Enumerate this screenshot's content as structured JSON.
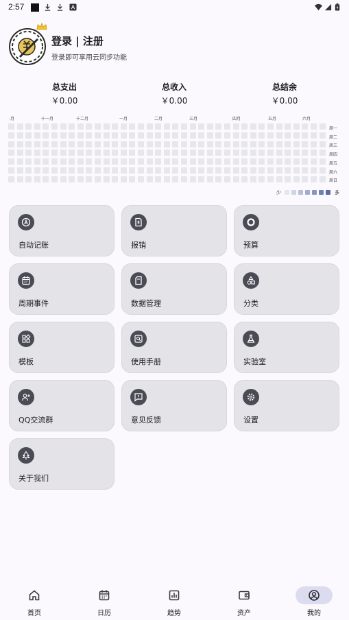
{
  "status_bar": {
    "time": "2:57",
    "icons": [
      "app-square-icon",
      "download-icon",
      "download-icon",
      "font-icon",
      "wifi-icon",
      "signal-icon",
      "battery-icon"
    ]
  },
  "profile": {
    "title": "登录 | 注册",
    "subtitle": "登录即可享用云同步功能"
  },
  "summary": [
    {
      "label": "总支出",
      "value": "￥0.00"
    },
    {
      "label": "总收入",
      "value": "￥0.00"
    },
    {
      "label": "总结余",
      "value": "￥0.00"
    }
  ],
  "heatmap": {
    "months": [
      "十月",
      "十一月",
      "十二月",
      "一月",
      "二月",
      "三月",
      "四月",
      "五月",
      "六月"
    ],
    "weekdays": [
      "周一",
      "周二",
      "周三",
      "周四",
      "周五",
      "周六",
      "周日"
    ],
    "legend_less": "少",
    "legend_more": "多",
    "empty_color": "#e6e6ec",
    "legend_colors": [
      "#e4e6ee",
      "#cfd3e3",
      "#b8bfd8",
      "#a1abcc",
      "#8996be",
      "#7080b0",
      "#5a6ca4"
    ]
  },
  "cards": [
    {
      "label": "自动记账",
      "icon": "auto-a-icon"
    },
    {
      "label": "报销",
      "icon": "receipt-icon"
    },
    {
      "label": "预算",
      "icon": "ring-icon"
    },
    {
      "label": "周期事件",
      "icon": "calendar-icon"
    },
    {
      "label": "数据管理",
      "icon": "sd-card-icon"
    },
    {
      "label": "分类",
      "icon": "category-shapes-icon"
    },
    {
      "label": "模板",
      "icon": "widgets-icon"
    },
    {
      "label": "使用手册",
      "icon": "manual-search-icon"
    },
    {
      "label": "实验室",
      "icon": "flask-icon"
    },
    {
      "label": "QQ交流群",
      "icon": "group-add-icon"
    },
    {
      "label": "意见反馈",
      "icon": "feedback-icon"
    },
    {
      "label": "设置",
      "icon": "gear-icon"
    },
    {
      "label": "关于我们",
      "icon": "tree-icon"
    }
  ],
  "nav": [
    {
      "label": "首页",
      "icon": "home-icon",
      "active": false
    },
    {
      "label": "日历",
      "icon": "calendar-icon",
      "active": false
    },
    {
      "label": "趋势",
      "icon": "chart-icon",
      "active": false
    },
    {
      "label": "资产",
      "icon": "wallet-icon",
      "active": false
    },
    {
      "label": "我的",
      "icon": "account-icon",
      "active": true
    }
  ],
  "colors": {
    "background": "#fbf9fd",
    "card": "#e3e3e8",
    "card_icon": "#4a4b55",
    "nav_active": "#dcdcf0",
    "coin": "#e8c45a"
  }
}
